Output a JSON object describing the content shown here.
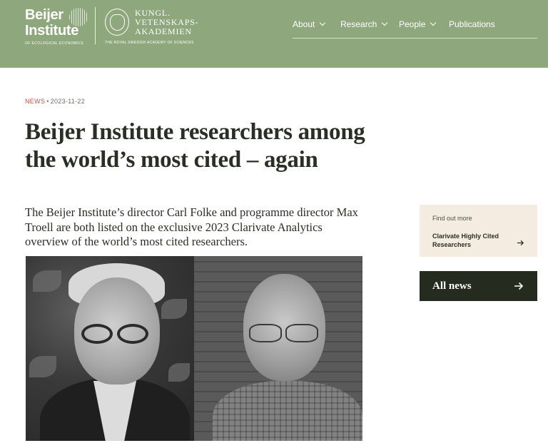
{
  "header": {
    "logo_name": "Beijer Institute",
    "logo_sub": "OF ECOLOGICAL ECONOMICS",
    "kva_lines": [
      "KUNGL.",
      "VETENSKAPS-",
      "AKADEMIEN"
    ],
    "kva_sub": "THE ROYAL SWEDISH ACADEMY OF SCIENCES",
    "nav": [
      {
        "label": "About",
        "has_dropdown": true,
        "icon": "chevron-down-icon"
      },
      {
        "label": "Research",
        "has_dropdown": true,
        "icon": "chevron-down-icon"
      },
      {
        "label": "People",
        "has_dropdown": true,
        "icon": "chevron-down-icon"
      },
      {
        "label": "Publications",
        "has_dropdown": false
      }
    ]
  },
  "article": {
    "category": "NEWS",
    "separator": "•",
    "date": "2023-11-22",
    "title": "Beijer Institute researchers among the world’s most cited – again",
    "lead": "The Beijer Institute’s director Carl Folke and programme director Max Troell are both listed on the exclusive 2023 Clarivate Analytics overview of the world’s most cited researchers."
  },
  "sidebar": {
    "find_out_more": "Find out more",
    "link_label": "Clarivate Highly Cited Researchers",
    "link_icon": "arrow-right-icon",
    "all_news": "All news",
    "all_news_icon": "arrow-right-icon"
  },
  "colors": {
    "header_bg": "#8fa77c",
    "accent_red": "#c0554a",
    "card_bg": "#f5ece1",
    "button_bg": "#252c1f"
  }
}
